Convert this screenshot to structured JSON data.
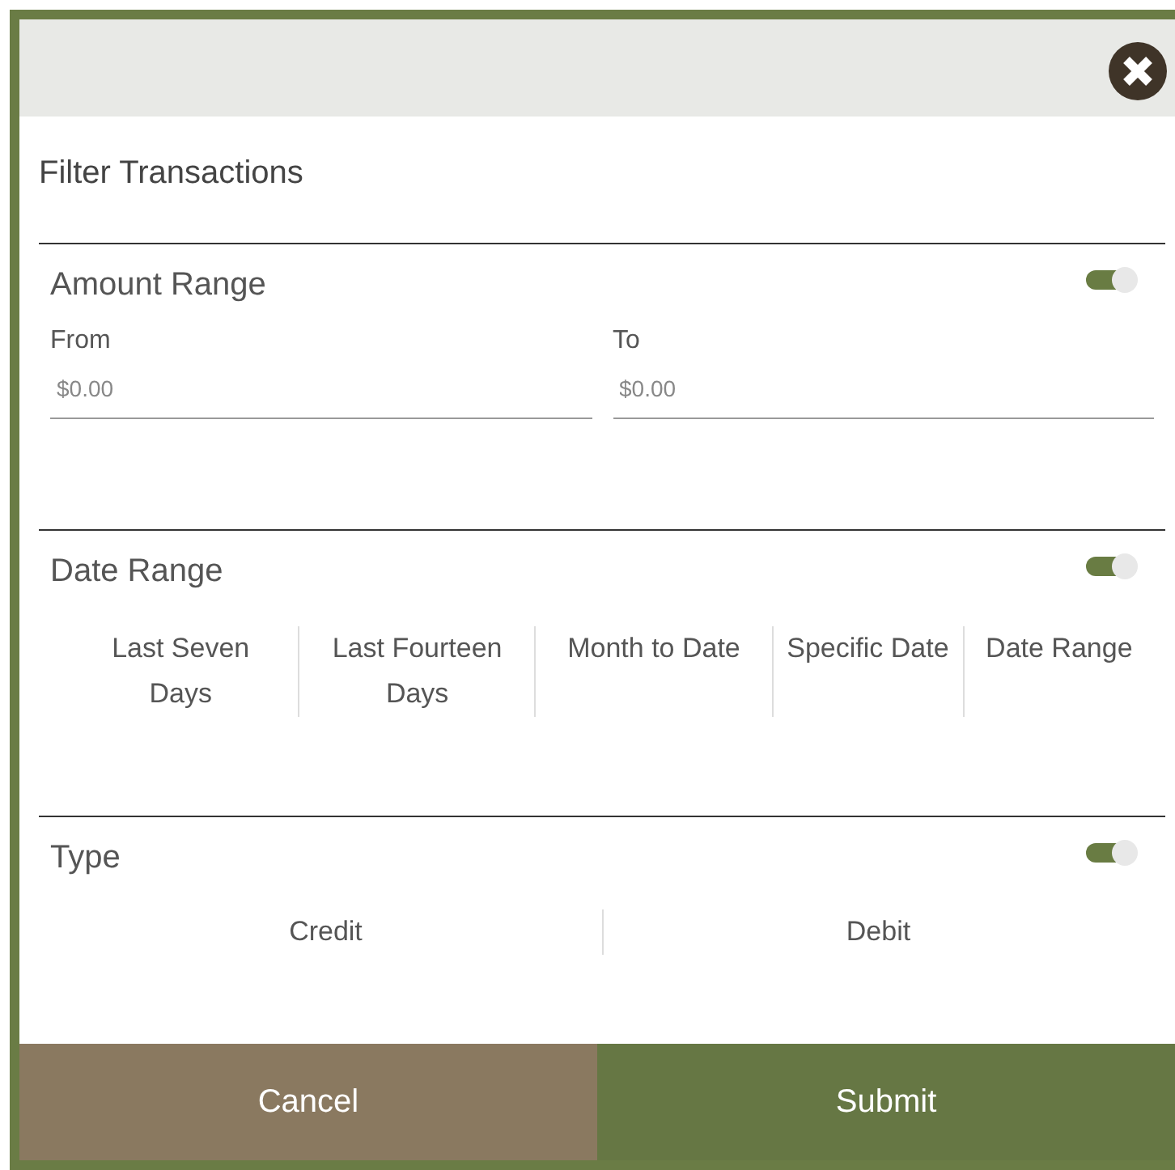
{
  "dialog": {
    "title": "Filter Transactions"
  },
  "sections": [
    {
      "kind": "amount",
      "heading": "Amount Range",
      "on": true,
      "fields": [
        {
          "label": "From",
          "placeholder": "$0.00"
        },
        {
          "label": "To",
          "placeholder": "$0.00"
        }
      ]
    },
    {
      "kind": "options",
      "heading": "Date Range",
      "on": true,
      "options": [
        "Last Seven Days",
        "Last Fourteen Days",
        "Month to Date",
        "Specific Date",
        "Date Range"
      ]
    },
    {
      "kind": "options",
      "heading": "Type",
      "on": true,
      "options": [
        "Credit",
        "Debit"
      ]
    }
  ],
  "buttons": [
    {
      "kind": "cancel",
      "label": "Cancel"
    },
    {
      "kind": "submit",
      "label": "Submit"
    }
  ]
}
